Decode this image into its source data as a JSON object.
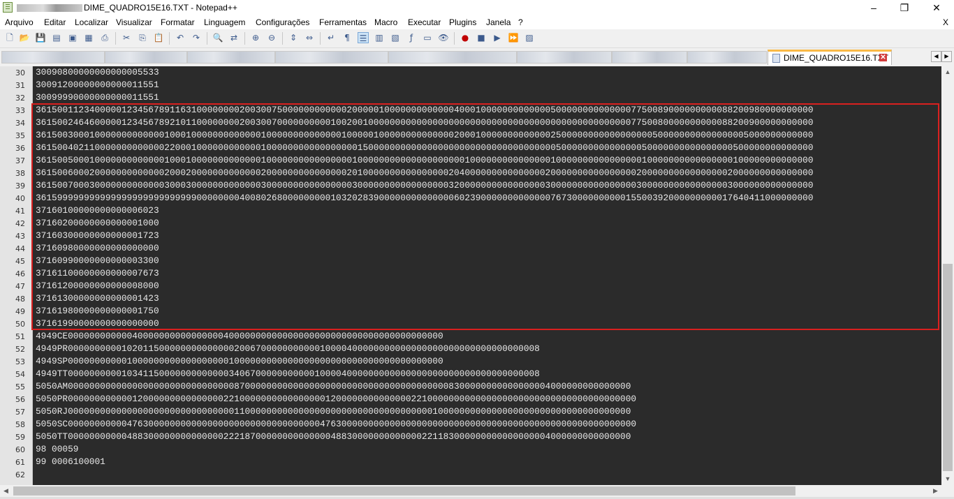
{
  "window": {
    "title": "DIME_QUADRO15E16.TXT - Notepad++",
    "minimize": "–",
    "maximize": "❐",
    "close": "✕"
  },
  "menu": {
    "items": [
      "Arquivo",
      "Editar",
      "Localizar",
      "Visualizar",
      "Formatar",
      "Linguagem",
      "Configurações",
      "Ferramentas",
      "Macro",
      "Executar",
      "Plugins",
      "Janela",
      "?"
    ],
    "close_doc": "X"
  },
  "tabs": {
    "active_label": "DIME_QUADRO15E16.TXT",
    "close_glyph": "✕"
  },
  "editor": {
    "lines": [
      {
        "num": "30",
        "text": "30090800000000000005533"
      },
      {
        "num": "31",
        "text": "30091200000000000011551"
      },
      {
        "num": "32",
        "text": "30099990000000000011551"
      },
      {
        "num": "33",
        "text": "3615001123400000123456789116310000000020030075000000000000200000100000000000004000100000000000005000000000000007750089000000000088200980000000000"
      },
      {
        "num": "34",
        "text": "3615002464600000123456789210110000000020030070000000000100200100000000000000000000000000000000000000000000000007750080000000000088200900000000000"
      },
      {
        "num": "35",
        "text": "3615003000100000000000001000100000000000001000000000000001000001000000000000002000100000000000002500000000000000000500000000000000005000000000000"
      },
      {
        "num": "36",
        "text": "3615004021100000000000002200010000000000001000000000000000001500000000000000000000000000000000000500000000000000050000000000000000500000000000000"
      },
      {
        "num": "37",
        "text": "3615005000100000000000001000100000000000001000000000000000010000000000000000000010000000000000001000000000000000010000000000000000100000000000000"
      },
      {
        "num": "38",
        "text": "3615006000200000000000002000200000000000002000000000000000201000000000000000020400000000000000020000000000000000200000000000000002000000000000000"
      },
      {
        "num": "39",
        "text": "3615007000300000000000003000300000000000003000000000000000030000000000000000032000000000000000030000000000000000300000000000000003000000000000000"
      },
      {
        "num": "40",
        "text": "3615999999999999999999999999990000000040080268000000000103202839000000000000006023900000000000007673000000000015500392000000000017640411000000000"
      },
      {
        "num": "41",
        "text": "37160100000000000006023"
      },
      {
        "num": "42",
        "text": "37160200000000000001000"
      },
      {
        "num": "43",
        "text": "37160300000000000001723"
      },
      {
        "num": "44",
        "text": "37160980000000000000000"
      },
      {
        "num": "45",
        "text": "37160990000000000003300"
      },
      {
        "num": "46",
        "text": "37161100000000000007673"
      },
      {
        "num": "47",
        "text": "37161200000000000008000"
      },
      {
        "num": "48",
        "text": "37161300000000000001423"
      },
      {
        "num": "49",
        "text": "37161980000000000001750"
      },
      {
        "num": "50",
        "text": "37161990000000000000000"
      },
      {
        "num": "51",
        "text": "4949CE0000000000004000000000000000040000000000000000000000000000000000000000"
      },
      {
        "num": "52",
        "text": "4949PR0000000000102011500000000000000200670000000000010000400000000000000000000000000000000008"
      },
      {
        "num": "53",
        "text": "4949SP0000000000010000000000000000001000000000000000000000000000000000000000"
      },
      {
        "num": "54",
        "text": "4949TT0000000000103411500000000000003406700000000000100004000000000000000000000000000000000008"
      },
      {
        "num": "55",
        "text": "5050AM000000000000000000000000000000087000000000000000000000000000000000000008300000000000000004000000000000000"
      },
      {
        "num": "56",
        "text": "5050PR0000000000001200000000000000022100000000000000001200000000000000221000000000000000000000000000000000000000"
      },
      {
        "num": "57",
        "text": "5050RJ000000000000000000000000000000011000000000000000000000000000000000001000000000000000000000000000000000000"
      },
      {
        "num": "58",
        "text": "5050SC0000000000047630000000000000000000000000000000047630000000000000000000000000000000000000000000000000000000"
      },
      {
        "num": "59",
        "text": "5050TT000000000004883000000000000002221870000000000000048830000000000000221183000000000000000004000000000000000"
      },
      {
        "num": "60",
        "text": "98  00059"
      },
      {
        "num": "61",
        "text": "99  0006100001"
      },
      {
        "num": "62",
        "text": ""
      }
    ]
  },
  "colors": {
    "editor_bg": "#2b2b2b",
    "highlight_border": "#d9201f",
    "active_tab_accent": "#fab946"
  }
}
